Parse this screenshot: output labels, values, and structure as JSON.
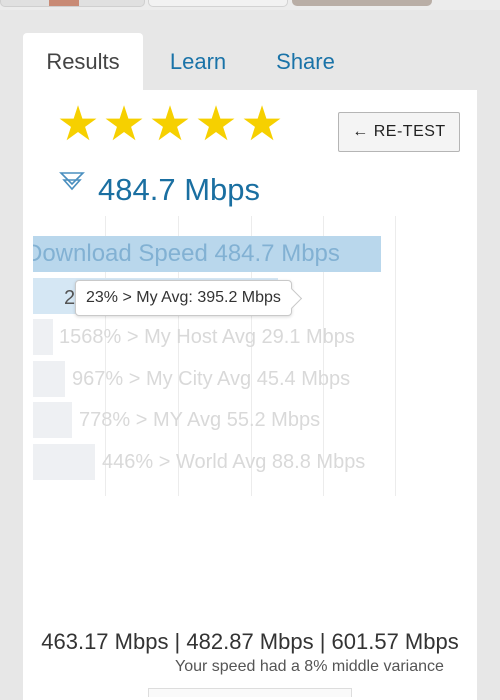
{
  "tabs": [
    {
      "label": "Results"
    },
    {
      "label": "Learn"
    },
    {
      "label": "Share"
    }
  ],
  "rating": {
    "stars": 5,
    "max": 5
  },
  "retest": {
    "label": "← RE-TEST"
  },
  "speed": {
    "value": "484.7 Mbps"
  },
  "chart_data": {
    "type": "bar",
    "orientation": "horizontal",
    "categories": [
      "Download Speed",
      "My Avg",
      "My Host Avg",
      "My City Avg",
      "MY Avg",
      "World Avg"
    ],
    "values": [
      484.7,
      395.2,
      29.1,
      45.4,
      55.2,
      88.8
    ],
    "unit": "Mbps",
    "labels": [
      "Download Speed 484.7 Mbps",
      "23% > My Avg: 395.2 Mbps",
      "1568% > My Host Avg 29.1 Mbps",
      "967% > My City Avg 45.4 Mbps",
      "778% > MY Avg 55.2 Mbps",
      "446% > World Avg 88.8 Mbps"
    ],
    "grid": true
  },
  "tooltip": {
    "text": "23% > My Avg: 395.2 Mbps"
  },
  "selected_digit": "2",
  "stats": {
    "line": "463.17 Mbps | 482.87 Mbps | 601.57 Mbps"
  },
  "variance": {
    "text": "Your speed had a 8% middle variance"
  },
  "colors": {
    "accent": "#1a6fa1",
    "star": "#f6d000",
    "bar_highlight": "#b9d7ec"
  }
}
